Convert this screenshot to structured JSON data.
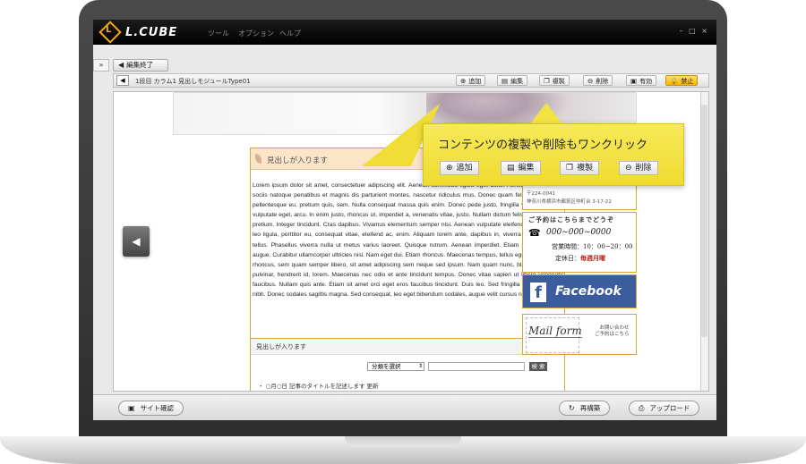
{
  "app": {
    "brand": "L.CUBE",
    "logo_letter": "L",
    "menu": [
      "ツール",
      "オプション",
      "ヘルプ"
    ],
    "window_controls": "– □ ×"
  },
  "editbar": {
    "collapse": "»",
    "end_edit": "編集終了",
    "back_arrow": "◀",
    "path": "1段目  カラム1  見出しモジュールType01",
    "buttons": [
      {
        "icon": "⊕",
        "label": "追加"
      },
      {
        "icon": "▤",
        "label": "編集"
      },
      {
        "icon": "❐",
        "label": "複製"
      },
      {
        "icon": "⊖",
        "label": "削除"
      },
      {
        "icon": "▣",
        "label": "有効"
      },
      {
        "icon": "🔒",
        "label": "禁止"
      }
    ]
  },
  "content": {
    "prev_arrow": "◀",
    "heading": "見出しが入ります",
    "body": "Lorem ipsum dolor sit amet, consectetuer adipiscing elit. Aenean commodo ligula eget dolor. Aenean massa. Cum sociis natoque penatibus et magnis dis parturient montes, nascetur ridiculus mus. Donec quam felis, ultricies nec, pellentesque eu, pretium quis, sem. Nulla consequat massa quis enim. Donec pede justo, fringilla vel, aliquet nec, vulputate eget, arcu. In enim justo, rhoncus ut, imperdiet a, venenatis vitae, justo. Nullam dictum felis eu pede mollis pretium. Integer tincidunt. Cras dapibus. Vivamus elementum semper nisi. Aenean vulputate eleifend tellus. Aenean leo ligula, porttitor eu, consequat vitae, eleifend ac, enim. Aliquam lorem ante, dapibus in, viverra quis, feugiat a, tellus. Phasellus viverra nulla ut metus varius laoreet. Quisque rutrum. Aenean imperdiet. Etiam ultricies nisi vel augue. Curabitur ullamcorper ultricies nisi. Nam eget dui. Etiam rhoncus. Maecenas tempus, tellus eget condimentum rhoncus, sem quam semper libero, sit amet adipiscing sem neque sed ipsum. Nam quam nunc, blandit vel, luctus pulvinar, hendrerit id, lorem. Maecenas nec odio et ante tincidunt tempus. Donec vitae sapien ut libero venenatis faucibus. Nullam quis ante. Etiam sit amet orci eget eros faucibus tincidunt. Duis leo. Sed fringilla mauris sit amet nibh. Donec sodales sagittis magna. Sed consequat, leo eget bibendum sodales, augue velit cursus nunc,",
    "sub_heading": "見出しが入ります",
    "category_select": "分類を選択",
    "search_button": "検 索",
    "news_item": "・ ○月○日  記事のタイトルを記述します     更新"
  },
  "sidebar": {
    "zip": "〒224-0041",
    "location": "神奈川県横浜市都筑区仲町台 3-17-22",
    "reserve_line": "ご予約はこちらまでどうぞ",
    "phone_icon": "☎",
    "tel": "000~000~0000",
    "hours": "営業時間：10：00~20：00",
    "closed_label": "定休日：",
    "closed_day": "毎週月曜",
    "facebook_letter": "f",
    "facebook": "Facebook",
    "mailform": "Mail form",
    "mail_note": "お問い合わせ\nご予約はこちら"
  },
  "callout": {
    "title": "コンテンツの複製や削除もワンクリック",
    "buttons": [
      {
        "icon": "⊕",
        "label": "追加"
      },
      {
        "icon": "▤",
        "label": "編集"
      },
      {
        "icon": "❐",
        "label": "複製"
      },
      {
        "icon": "⊖",
        "label": "削除"
      }
    ]
  },
  "bottombar": {
    "site_check": "サイト確認",
    "site_check_icon": "▣",
    "rebuild": "再構築",
    "rebuild_icon": "↻",
    "upload": "アップロード",
    "upload_icon": "⎙"
  },
  "colors": {
    "accent_orange": "#f2a51a",
    "frame_border": "#d9a43a",
    "callout_yellow": "#f7ea5a",
    "facebook_blue": "#3b5c9d"
  }
}
